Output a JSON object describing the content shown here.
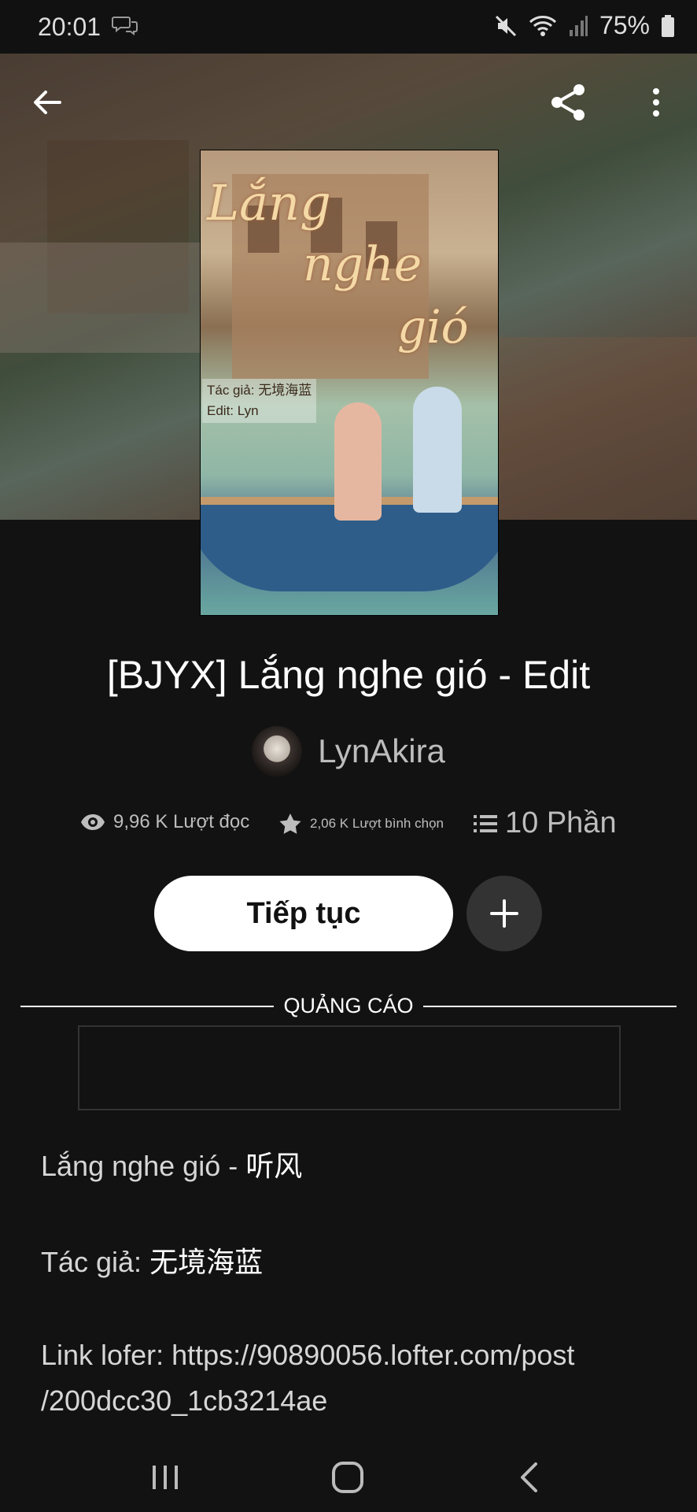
{
  "status_bar": {
    "time": "20:01",
    "battery": "75%"
  },
  "cover": {
    "title_line1": "Lắng",
    "title_line2": "nghe",
    "title_line3": "gió",
    "caption_author": "Tác giả: 无境海蓝",
    "caption_editor": "Edit: Lyn"
  },
  "story": {
    "title": "[BJYX] Lắng nghe gió - Edit",
    "author": "LynAkira",
    "reads": "9,96 K Lượt đọc",
    "votes": "2,06 K Lượt bình chọn",
    "parts": "10 Phần"
  },
  "actions": {
    "continue_label": "Tiếp tục"
  },
  "ad": {
    "label": "QUẢNG CÁO"
  },
  "description": {
    "line1_prefix": "Lắng nghe gió - ",
    "line1_cn": "听风",
    "line2_prefix": "Tác giả: ",
    "line2_cn": "无境海蓝",
    "line3a": "Link lofer: https://90890056.lofter.com/post",
    "line3b": "/200dcc30_1cb3214ae"
  },
  "icons": [
    "back-arrow-icon",
    "share-icon",
    "more-vertical-icon",
    "eye-icon",
    "star-icon",
    "list-icon",
    "plus-icon"
  ]
}
